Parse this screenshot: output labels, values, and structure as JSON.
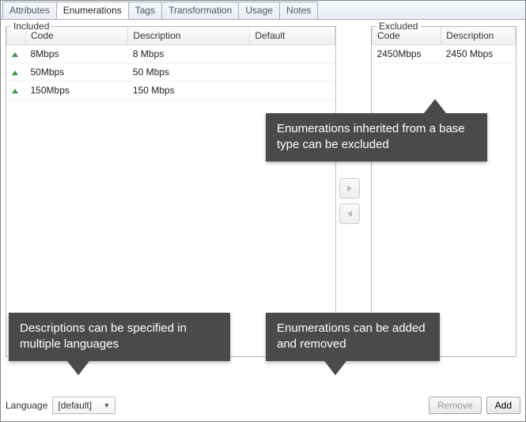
{
  "tabs": [
    "Attributes",
    "Enumerations",
    "Tags",
    "Transformation",
    "Usage",
    "Notes"
  ],
  "active_tab_index": 1,
  "included": {
    "legend": "Included",
    "headers": {
      "code": "Code",
      "description": "Description",
      "default": "Default"
    },
    "rows": [
      {
        "code": "8Mbps",
        "description": "8 Mbps",
        "default": ""
      },
      {
        "code": "50Mbps",
        "description": "50 Mbps",
        "default": ""
      },
      {
        "code": "150Mbps",
        "description": "150 Mbps",
        "default": ""
      }
    ]
  },
  "excluded": {
    "legend": "Excluded",
    "headers": {
      "code": "Code",
      "description": "Description"
    },
    "rows": [
      {
        "code": "2450Mbps",
        "description": "2450 Mbps"
      }
    ]
  },
  "mid_buttons": {
    "to_right_icon": "move-right-icon",
    "to_left_icon": "move-left-icon"
  },
  "bottom": {
    "language_label": "Language",
    "language_value": "[default]",
    "remove_label": "Remove",
    "add_label": "Add"
  },
  "callouts": {
    "c1": "Enumerations inherited from a base type can be excluded",
    "c2": "Descriptions can be specified in multiple languages",
    "c3": "Enumerations can be added and removed"
  }
}
